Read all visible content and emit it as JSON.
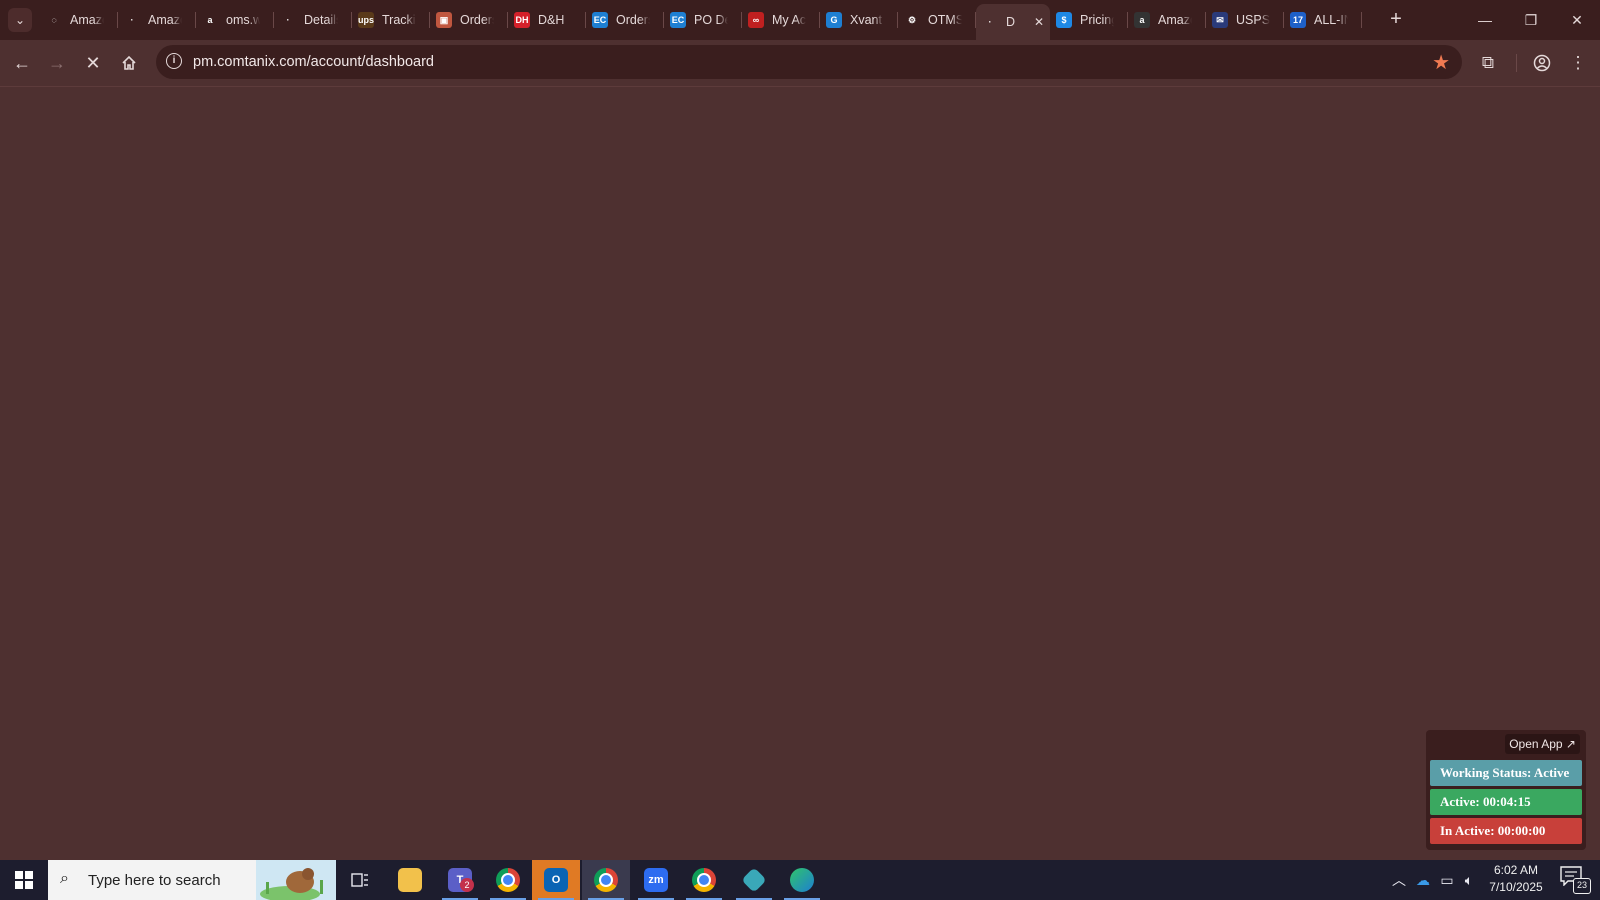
{
  "browser": {
    "tabs": [
      {
        "label": "Amazon",
        "fav": "spinner",
        "fav_color": "#3a1e1e"
      },
      {
        "label": "Amazon",
        "fav": "dot",
        "fav_color": "#3a1e1e"
      },
      {
        "label": "oms.w",
        "fav": "a",
        "fav_color": "#3a1e1e"
      },
      {
        "label": "Details",
        "fav": "dot",
        "fav_color": "#3a1e1e"
      },
      {
        "label": "Tracking",
        "fav": "ups",
        "fav_color": "#5a3a1a"
      },
      {
        "label": "Orders",
        "fav": "box",
        "fav_color": "#c0573f"
      },
      {
        "label": "D&H",
        "fav": "dh",
        "fav_color": "#d4202a"
      },
      {
        "label": "Orders",
        "fav": "EC",
        "fav_color": "#1e7fd2"
      },
      {
        "label": "PO De",
        "fav": "EC",
        "fav_color": "#1e7fd2"
      },
      {
        "label": "My Ac",
        "fav": "rings",
        "fav_color": "#c02020"
      },
      {
        "label": "Xvant",
        "fav": "G",
        "fav_color": "#1e7fd2"
      },
      {
        "label": "OTMS",
        "fav": "otms",
        "fav_color": "#3a1e1e"
      },
      {
        "label": "D",
        "fav": "dot",
        "fav_color": "#4e3030",
        "active": true
      },
      {
        "label": "Pricing",
        "fav": "S",
        "fav_color": "#1e88e5"
      },
      {
        "label": "Amazon",
        "fav": "a",
        "fav_color": "#333"
      },
      {
        "label": "USPS",
        "fav": "usps",
        "fav_color": "#2a3a7a"
      },
      {
        "label": "ALL-IN",
        "fav": "17",
        "fav_color": "#1e60c8"
      }
    ],
    "url": "pm.comtanix.com/account/dashboard",
    "accent_star": "#f07a52"
  },
  "widget": {
    "open_app": "Open App ↗",
    "working_status": "Working Status: Active",
    "active": "Active: 00:04:15",
    "inactive": "In Active: 00:00:00",
    "status_color": "#5a9ea8",
    "active_color": "#3aa860",
    "inactive_color": "#c8403a"
  },
  "taskbar": {
    "search_placeholder": "Type here to search",
    "teams_badge": "2",
    "time": "6:02 AM",
    "date": "7/10/2025",
    "notification_count": "23"
  }
}
